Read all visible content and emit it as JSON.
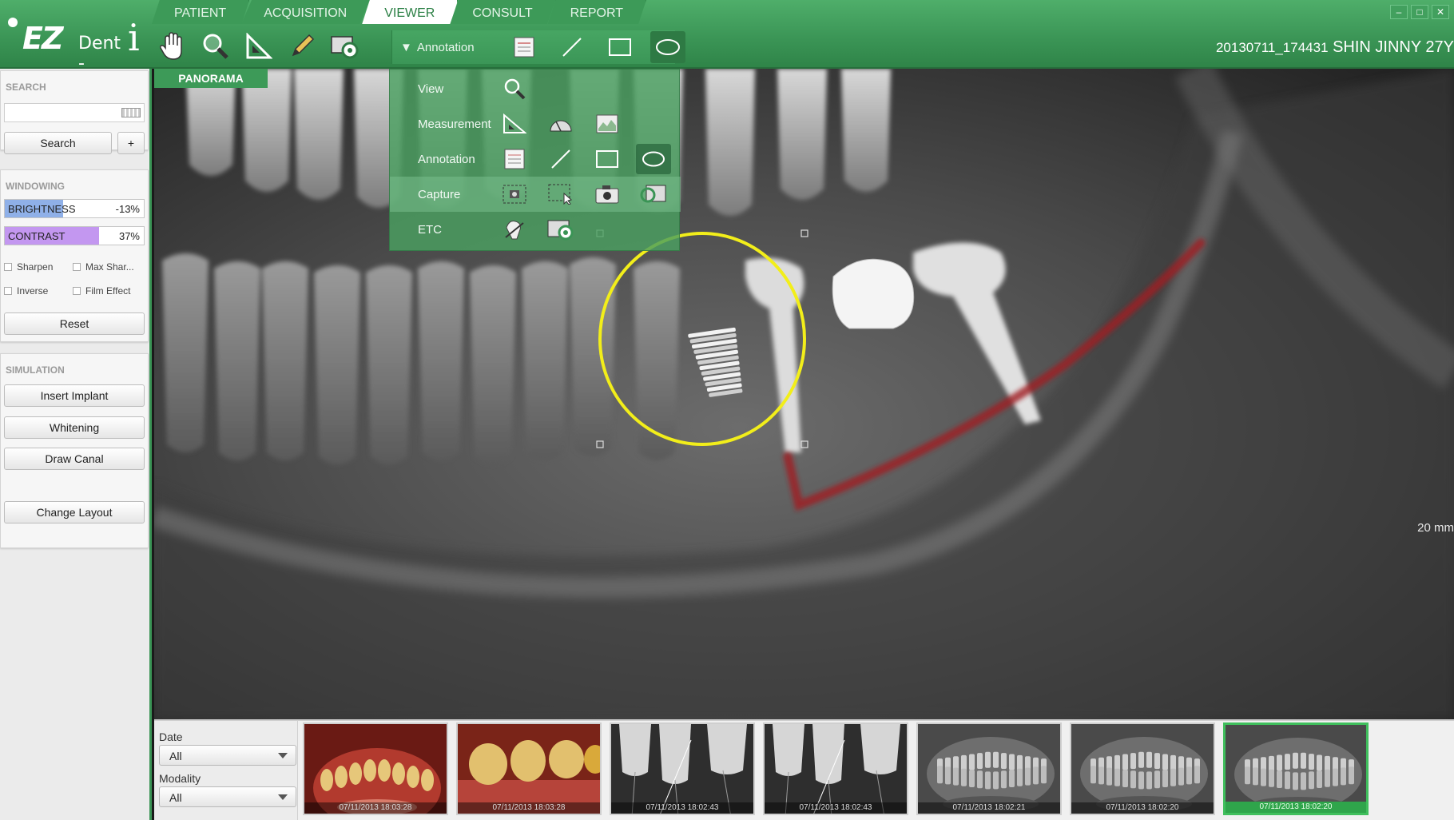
{
  "app": {
    "logo_ez": "EZ",
    "logo_dent": "Dent -",
    "logo_i": "i"
  },
  "tabs": [
    {
      "label": "PATIENT"
    },
    {
      "label": "ACQUISITION"
    },
    {
      "label": "VIEWER",
      "active": true
    },
    {
      "label": "CONSULT"
    },
    {
      "label": "REPORT"
    }
  ],
  "window_controls": {
    "min": "–",
    "max": "□",
    "close": "✕"
  },
  "patient": {
    "id": "20130711_174431",
    "name": "SHIN JINNY 27Y"
  },
  "toolbar": {
    "annotation_label": "Annotation",
    "icons": [
      "hand-icon",
      "magnifier-icon",
      "ruler-icon",
      "pencil-icon",
      "capture-icon"
    ]
  },
  "left": {
    "search": {
      "title": "SEARCH",
      "placeholder": "",
      "button": "Search",
      "add": "+"
    },
    "windowing": {
      "title": "WINDOWING",
      "brightness": {
        "label": "BRIGHTNESS",
        "value": "-13%",
        "level": 0.42
      },
      "contrast": {
        "label": "CONTRAST",
        "value": "37%",
        "level": 0.68
      },
      "sharpen": "Sharpen",
      "max_sharpen": "Max Shar...",
      "inverse": "Inverse",
      "film_effect": "Film Effect",
      "reset": "Reset"
    },
    "simulation": {
      "title": "SIMULATION",
      "insert_implant": "Insert Implant",
      "whitening": "Whitening",
      "draw_canal": "Draw Canal"
    },
    "change_layout": "Change Layout"
  },
  "viewer": {
    "label": "PANORAMA",
    "scale": "20 mm",
    "toolbox": [
      {
        "label": "View"
      },
      {
        "label": "Measurement"
      },
      {
        "label": "Annotation"
      },
      {
        "label": "Capture"
      },
      {
        "label": "ETC"
      }
    ],
    "annotation_color": "#f2ee1a",
    "canal_color": "#a01a22"
  },
  "bottom": {
    "date_label": "Date",
    "date_value": "All",
    "modality_label": "Modality",
    "modality_value": "All",
    "thumbnails": [
      {
        "date": "07/11/2013 18:03:28",
        "kind": "photo-lower"
      },
      {
        "date": "07/11/2013 18:03:28",
        "kind": "photo-molars"
      },
      {
        "date": "07/11/2013 18:02:43",
        "kind": "xray-periapical"
      },
      {
        "date": "07/11/2013 18:02:43",
        "kind": "xray-periapical"
      },
      {
        "date": "07/11/2013 18:02:21",
        "kind": "xray-panorama"
      },
      {
        "date": "07/11/2013 18:02:20",
        "kind": "xray-panorama"
      },
      {
        "date": "07/11/2013 18:02:20",
        "kind": "xray-panorama",
        "selected": true
      }
    ]
  }
}
